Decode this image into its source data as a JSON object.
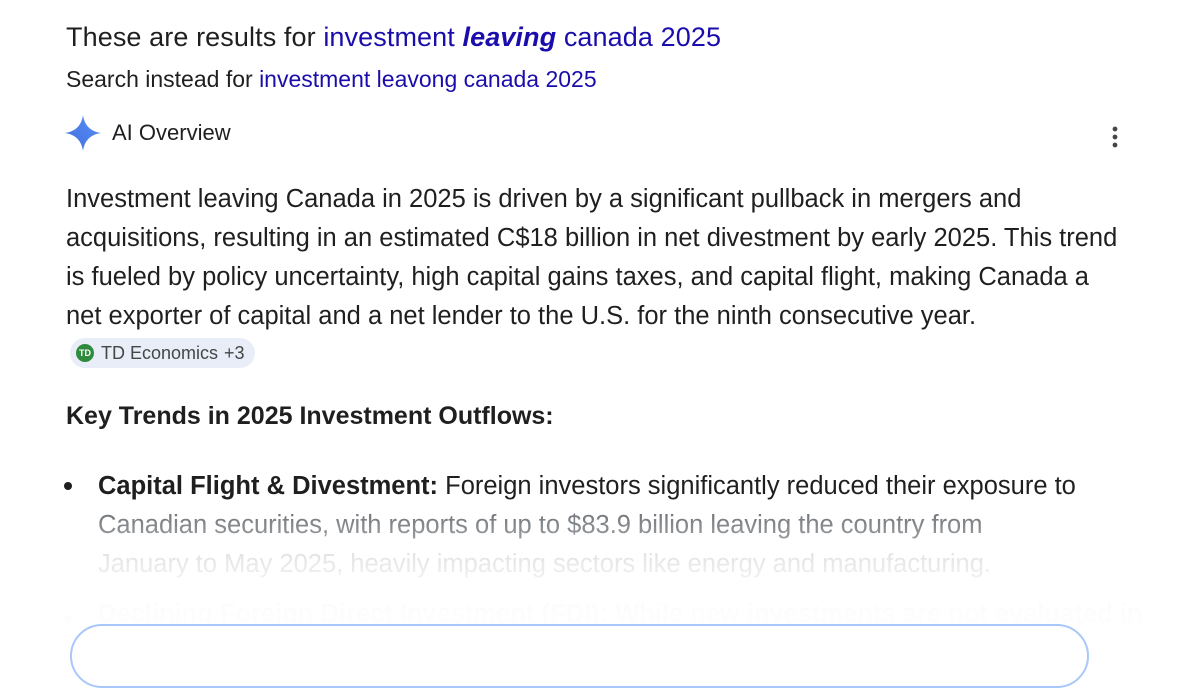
{
  "correction": {
    "prefix": "These are results for ",
    "query_part1": "investment ",
    "query_emphasis": "leaving",
    "query_part2": " canada 2025"
  },
  "search_instead": {
    "prefix": "Search instead for ",
    "query": "investment leavong canada 2025"
  },
  "ai_overview": {
    "title": "AI Overview",
    "icons": {
      "spark": "gemini-spark-icon",
      "more": "more-vertical-icon"
    },
    "summary": "Investment leaving Canada in 2025 is driven by a significant pullback in mergers and acquisitions, resulting in an estimated C$18 billion in net divestment by early 2025. This trend is fueled by policy uncertainty, high capital gains taxes, and capital flight, making Canada a net exporter of capital and a net lender to the U.S. for the ninth consecutive year.",
    "source_chip": {
      "logo_text": "TD",
      "label": "TD Economics",
      "more": "+3"
    },
    "key_heading": "Key Trends in 2025 Investment Outflows:",
    "bullets": [
      {
        "title": "Capital Flight & Divestment:",
        "text_line1": " Foreign investors significantly reduced their exposure to",
        "text_line2": "Canadian securities, with reports of up to $83.9 billion leaving the country from",
        "text_line3": "January to May 2025, heavily impacting sectors like energy and manufacturing."
      },
      {
        "title": "Declining Foreign Direct Investment (FDI): While new investments are not evaluated in"
      }
    ]
  },
  "colors": {
    "link": "#1a0dab",
    "text": "#1f1f1f",
    "chip_bg": "#e8edf7",
    "accent_border": "#a8c7fa"
  }
}
